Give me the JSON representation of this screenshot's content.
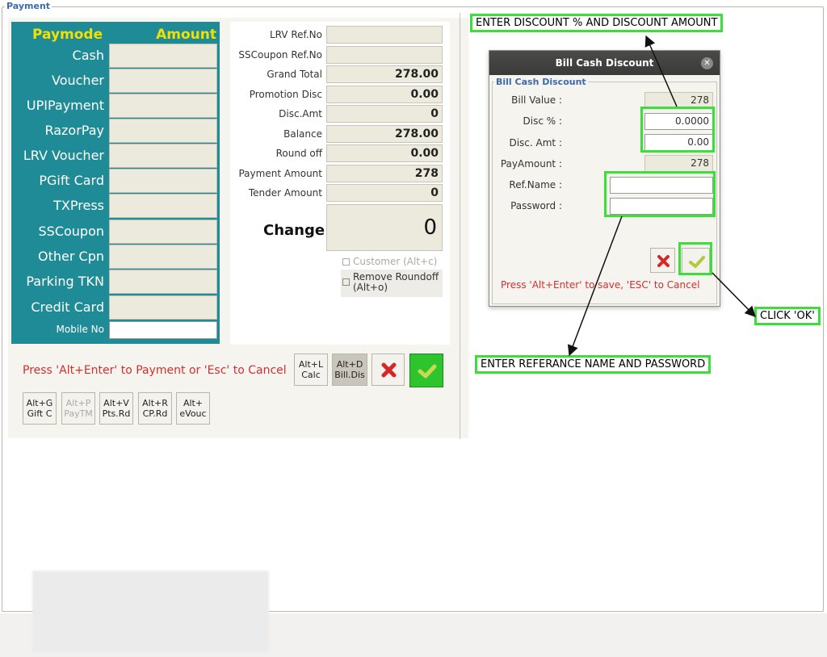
{
  "payment": {
    "legend": "Payment",
    "paymode_header": "Paymode",
    "amount_header": "Amount",
    "modes": [
      "Cash",
      "Voucher",
      "UPIPayment",
      "RazorPay",
      "LRV Voucher",
      "PGift Card",
      "TXPress",
      "SSCoupon",
      "Other Cpn",
      "Parking TKN",
      "Credit Card"
    ],
    "mobile_label": "Mobile No",
    "summary": [
      {
        "label": "LRV Ref.No",
        "value": ""
      },
      {
        "label": "SSCoupon Ref.No",
        "value": ""
      },
      {
        "label": "Grand Total",
        "value": "278.00"
      },
      {
        "label": "Promotion Disc",
        "value": "0.00"
      },
      {
        "label": "Disc.Amt",
        "value": "0"
      },
      {
        "label": "Balance",
        "value": "278.00"
      },
      {
        "label": "Round off",
        "value": "0.00"
      },
      {
        "label": "Payment Amount",
        "value": "278"
      },
      {
        "label": "Tender Amount",
        "value": "0"
      }
    ],
    "change_label": "Change",
    "change_value": "0",
    "customer_check": "Customer (Alt+c)",
    "remove_roundoff_check_1": "Remove Roundoff",
    "remove_roundoff_check_2": "(Alt+o)",
    "hint": "Press 'Alt+Enter' to Payment or 'Esc' to Cancel",
    "calc_btn": [
      "Alt+L",
      "Calc"
    ],
    "billdis_btn": [
      "Alt+D",
      "Bill.Dis"
    ],
    "shortcut_btns": [
      [
        "Alt+G",
        "Gift C"
      ],
      [
        "Alt+P",
        "PayTM"
      ],
      [
        "Alt+V",
        "Pts.Rd"
      ],
      [
        "Alt+R",
        "CP.Rd"
      ],
      [
        "Alt+",
        "eVouc"
      ]
    ]
  },
  "dialog": {
    "title": "Bill Cash Discount",
    "legend": "Bill Cash Discount",
    "bill_value_label": "Bill Value :",
    "bill_value": "278",
    "disc_pct_label": "Disc % :",
    "disc_pct": "0.0000",
    "disc_amt_label": "Disc. Amt :",
    "disc_amt": "0.00",
    "pay_amount_label": "PayAmount :",
    "pay_amount": "278",
    "ref_name_label": "Ref.Name :",
    "password_label": "Password :",
    "hint": "Press 'Alt+Enter' to save, 'ESC' to Cancel"
  },
  "annotations": {
    "discount": "ENTER DISCOUNT % AND DISCOUNT AMOUNT",
    "ok": "CLICK 'OK'",
    "reference": "ENTER REFERANCE NAME AND PASSWORD"
  },
  "colors": {
    "paymode_bg": "#1f8b96",
    "header_yellow": "#f4e000",
    "highlight_green": "#38e038",
    "hint_red": "#d32f2f"
  }
}
